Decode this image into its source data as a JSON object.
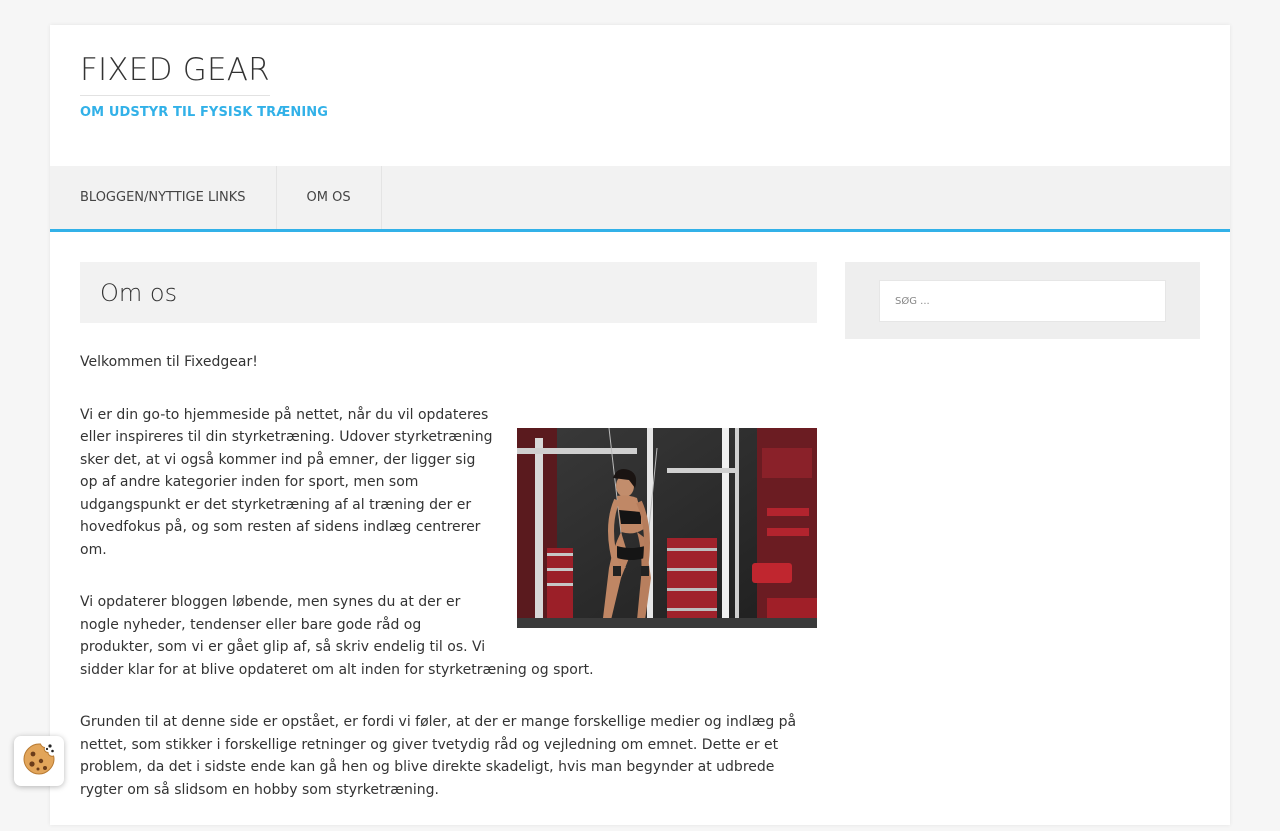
{
  "site": {
    "title": "FIXED GEAR",
    "tagline": "OM UDSTYR TIL FYSISK TRÆNING",
    "accent_color": "#32b1e8"
  },
  "nav": {
    "items": [
      {
        "label": "BLOGGEN/NYTTIGE LINKS"
      },
      {
        "label": "OM OS"
      }
    ]
  },
  "main": {
    "page_title": "Om os",
    "paragraphs": [
      "Velkommen til Fixedgear!",
      "Vi er din go-to hjemmeside på nettet, når du vil opdateres eller inspireres til din styrketræning. Udover styrketræning sker det, at vi også kommer ind på emner, der ligger sig op af andre kategorier inden for sport, men som udgangspunkt er det styrketræning af al træning der er hovedfokus på, og som resten af sidens indlæg centrerer om.",
      "Vi opdaterer bloggen løbende, men synes du at der er nogle nyheder, tendenser eller bare gode råd og produkter, som vi er gået glip af, så skriv endelig til os. Vi sidder klar for at blive opdateret om alt inden for styrketræning og sport.",
      "Grunden til at denne side er opstået, er fordi vi føler, at der er mange forskellige medier og indlæg på nettet, som stikker i forskellige retninger og giver tvetydig råd og vejledning om emnet. Dette er et problem, da det i sidste ende kan gå hen og blive direkte skadeligt, hvis man begynder at udbrede rygter om så slidsom en hobby som styrketræning."
    ]
  },
  "sidebar": {
    "search_placeholder": "SØG ..."
  },
  "cookie": {
    "icon": "cookie-icon"
  }
}
